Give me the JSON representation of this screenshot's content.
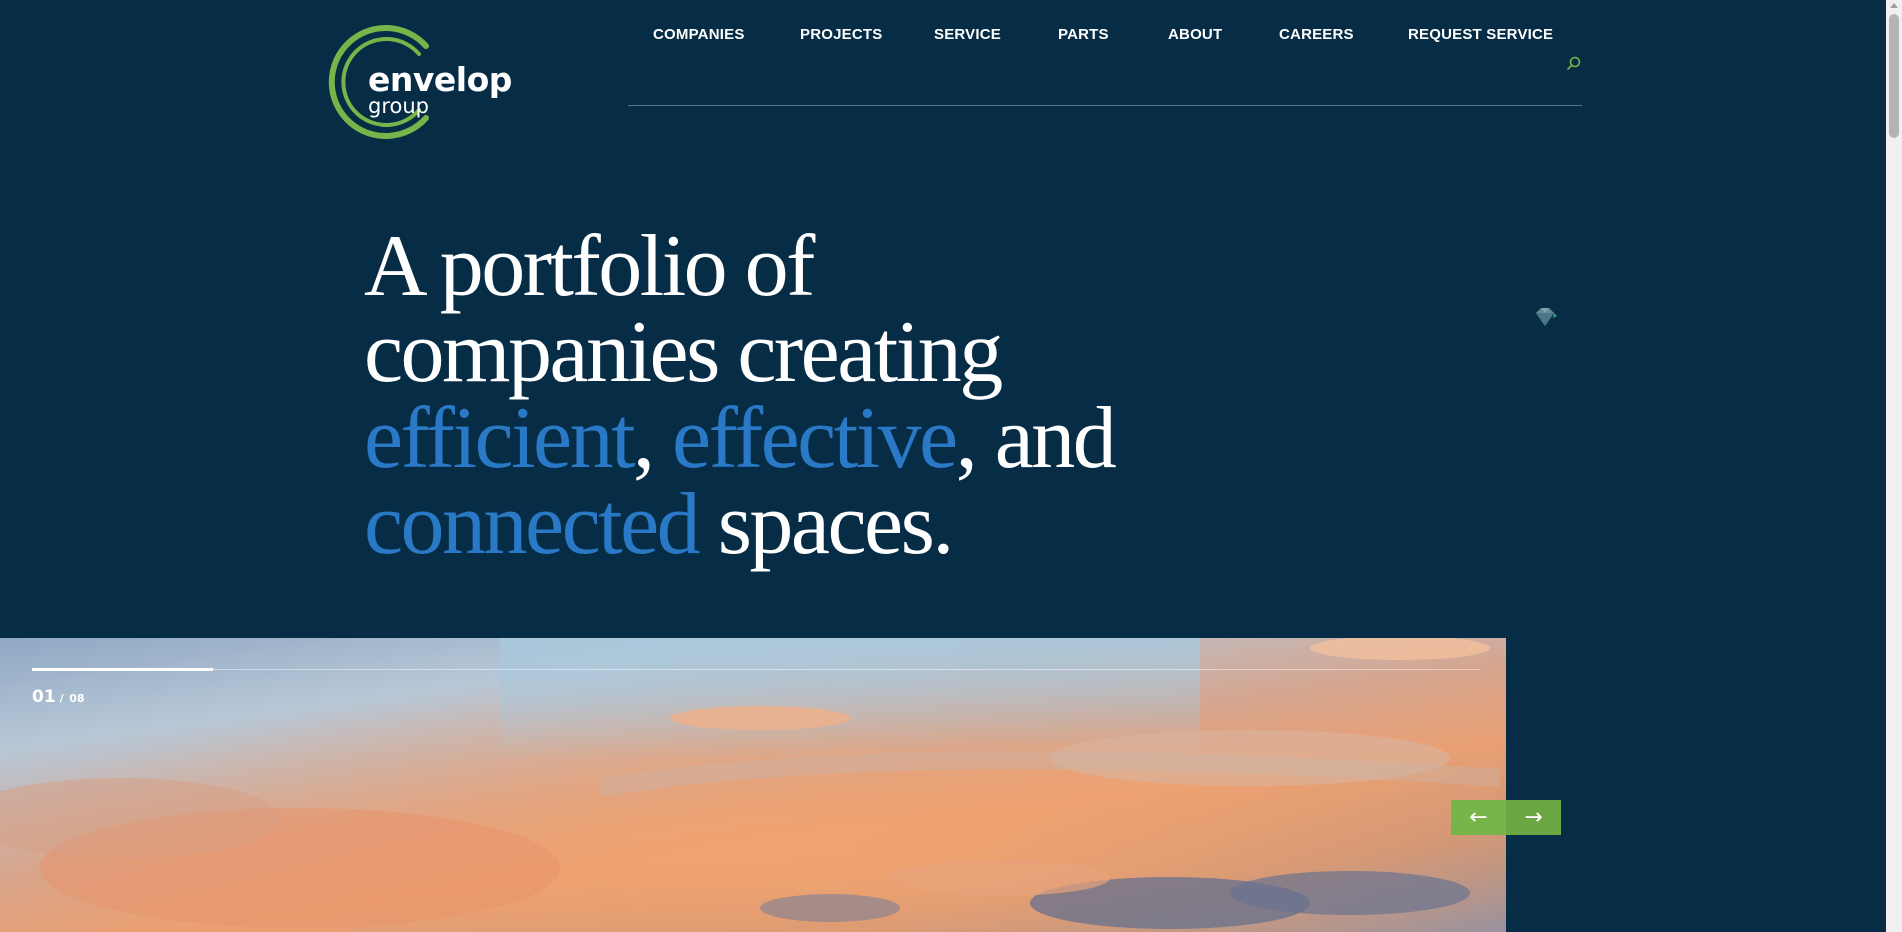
{
  "brand": {
    "name": "envelop",
    "sub": "group",
    "accent_color": "#77b54a",
    "headline_blue": "#2a79c7",
    "background": "#062d45"
  },
  "nav": {
    "items": [
      {
        "label": "COMPANIES"
      },
      {
        "label": "PROJECTS"
      },
      {
        "label": "SERVICE"
      },
      {
        "label": "PARTS"
      },
      {
        "label": "ABOUT"
      },
      {
        "label": "CAREERS"
      },
      {
        "label": "REQUEST SERVICE"
      }
    ],
    "search_icon": "search-icon"
  },
  "hero": {
    "line1": "A portfolio of",
    "line2": "companies creating",
    "w_efficient": "efficient",
    "comma1": ",",
    "w_effective": "effective",
    "and_text": ", and",
    "w_connected": "connected",
    "spaces_text": "spaces."
  },
  "slider": {
    "current": "01",
    "separator": "/",
    "total": "08",
    "progress": 0.125,
    "prev_icon": "arrow-left-icon",
    "next_icon": "arrow-right-icon",
    "prev_glyph": "←",
    "next_glyph": "→"
  }
}
